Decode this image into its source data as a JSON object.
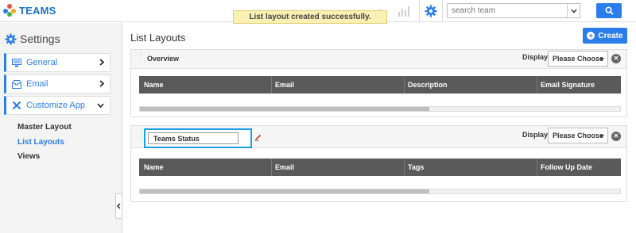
{
  "app": {
    "title": "TEAMS"
  },
  "toast": {
    "message": "List layout created successfully."
  },
  "search": {
    "placeholder": "search team",
    "value": ""
  },
  "sidebar": {
    "title": "Settings",
    "items": [
      {
        "label": "General",
        "icon": "monitor-icon"
      },
      {
        "label": "Email",
        "icon": "inbox-icon"
      },
      {
        "label": "Customize App",
        "icon": "tools-icon",
        "expanded": true
      }
    ],
    "subitems": [
      {
        "label": "Master Layout",
        "active": false
      },
      {
        "label": "List Layouts",
        "active": true
      },
      {
        "label": "Views",
        "active": false
      }
    ]
  },
  "main": {
    "title": "List Layouts",
    "create_label": "Create",
    "layouts": [
      {
        "name": "Overview",
        "display_label": "Display",
        "display_value": "Please Choose",
        "columns": [
          "Name",
          "Email",
          "Description",
          "Email Signature"
        ]
      },
      {
        "name": "Teams Status",
        "editing": true,
        "display_label": "Display",
        "display_value": "Please Choose",
        "columns": [
          "Name",
          "Email",
          "Tags",
          "Follow Up Date"
        ]
      }
    ]
  },
  "colors": {
    "accent": "#2b7de9",
    "toast_bg": "#fbf0b3",
    "grid_header": "#5a5a5a",
    "edit_outline": "#1aa0e6"
  }
}
